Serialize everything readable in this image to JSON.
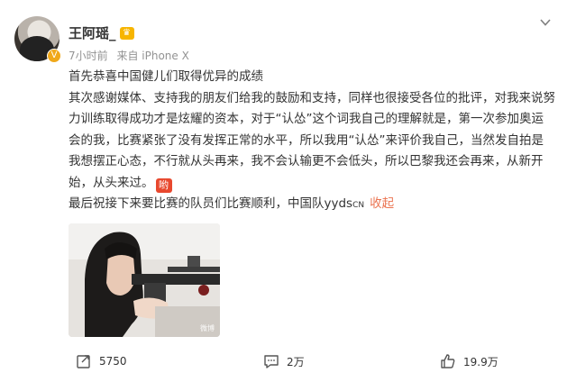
{
  "post": {
    "author": "王阿瑶_",
    "time": "7小时前",
    "source": "来自 iPhone X",
    "paragraphs": [
      "首先恭喜中国健儿们取得优异的成绩",
      "其次感谢媒体、支持我的朋友们给我的鼓励和支持，同样也很接受各位的批评，对我来说努力训练取得成功才是炫耀的资本，对于“认怂”这个词我自己的理解就是，第一次参加奥运会的我，比赛紧张了没有发挥正常的水平，所以我用“认怂”来评价我自己，当然发自拍是我想摆正心态，不行就从头再来，我不会认输更不会低头，所以巴黎我还会再来，从新开始，从头来过。"
    ],
    "last_line": "最后祝接下来要比赛的队员们比赛顺利，中国队yyds",
    "last_line_suffix": "CN",
    "collapse_label": "收起",
    "emoji_text": "哟",
    "photo_watermark": "微博"
  },
  "actions": {
    "repost_count": "5750",
    "comment_count": "2万",
    "like_count": "19.9万"
  },
  "colors": {
    "accent": "#eb7350",
    "meta": "#939393",
    "vip": "#f7b500"
  }
}
